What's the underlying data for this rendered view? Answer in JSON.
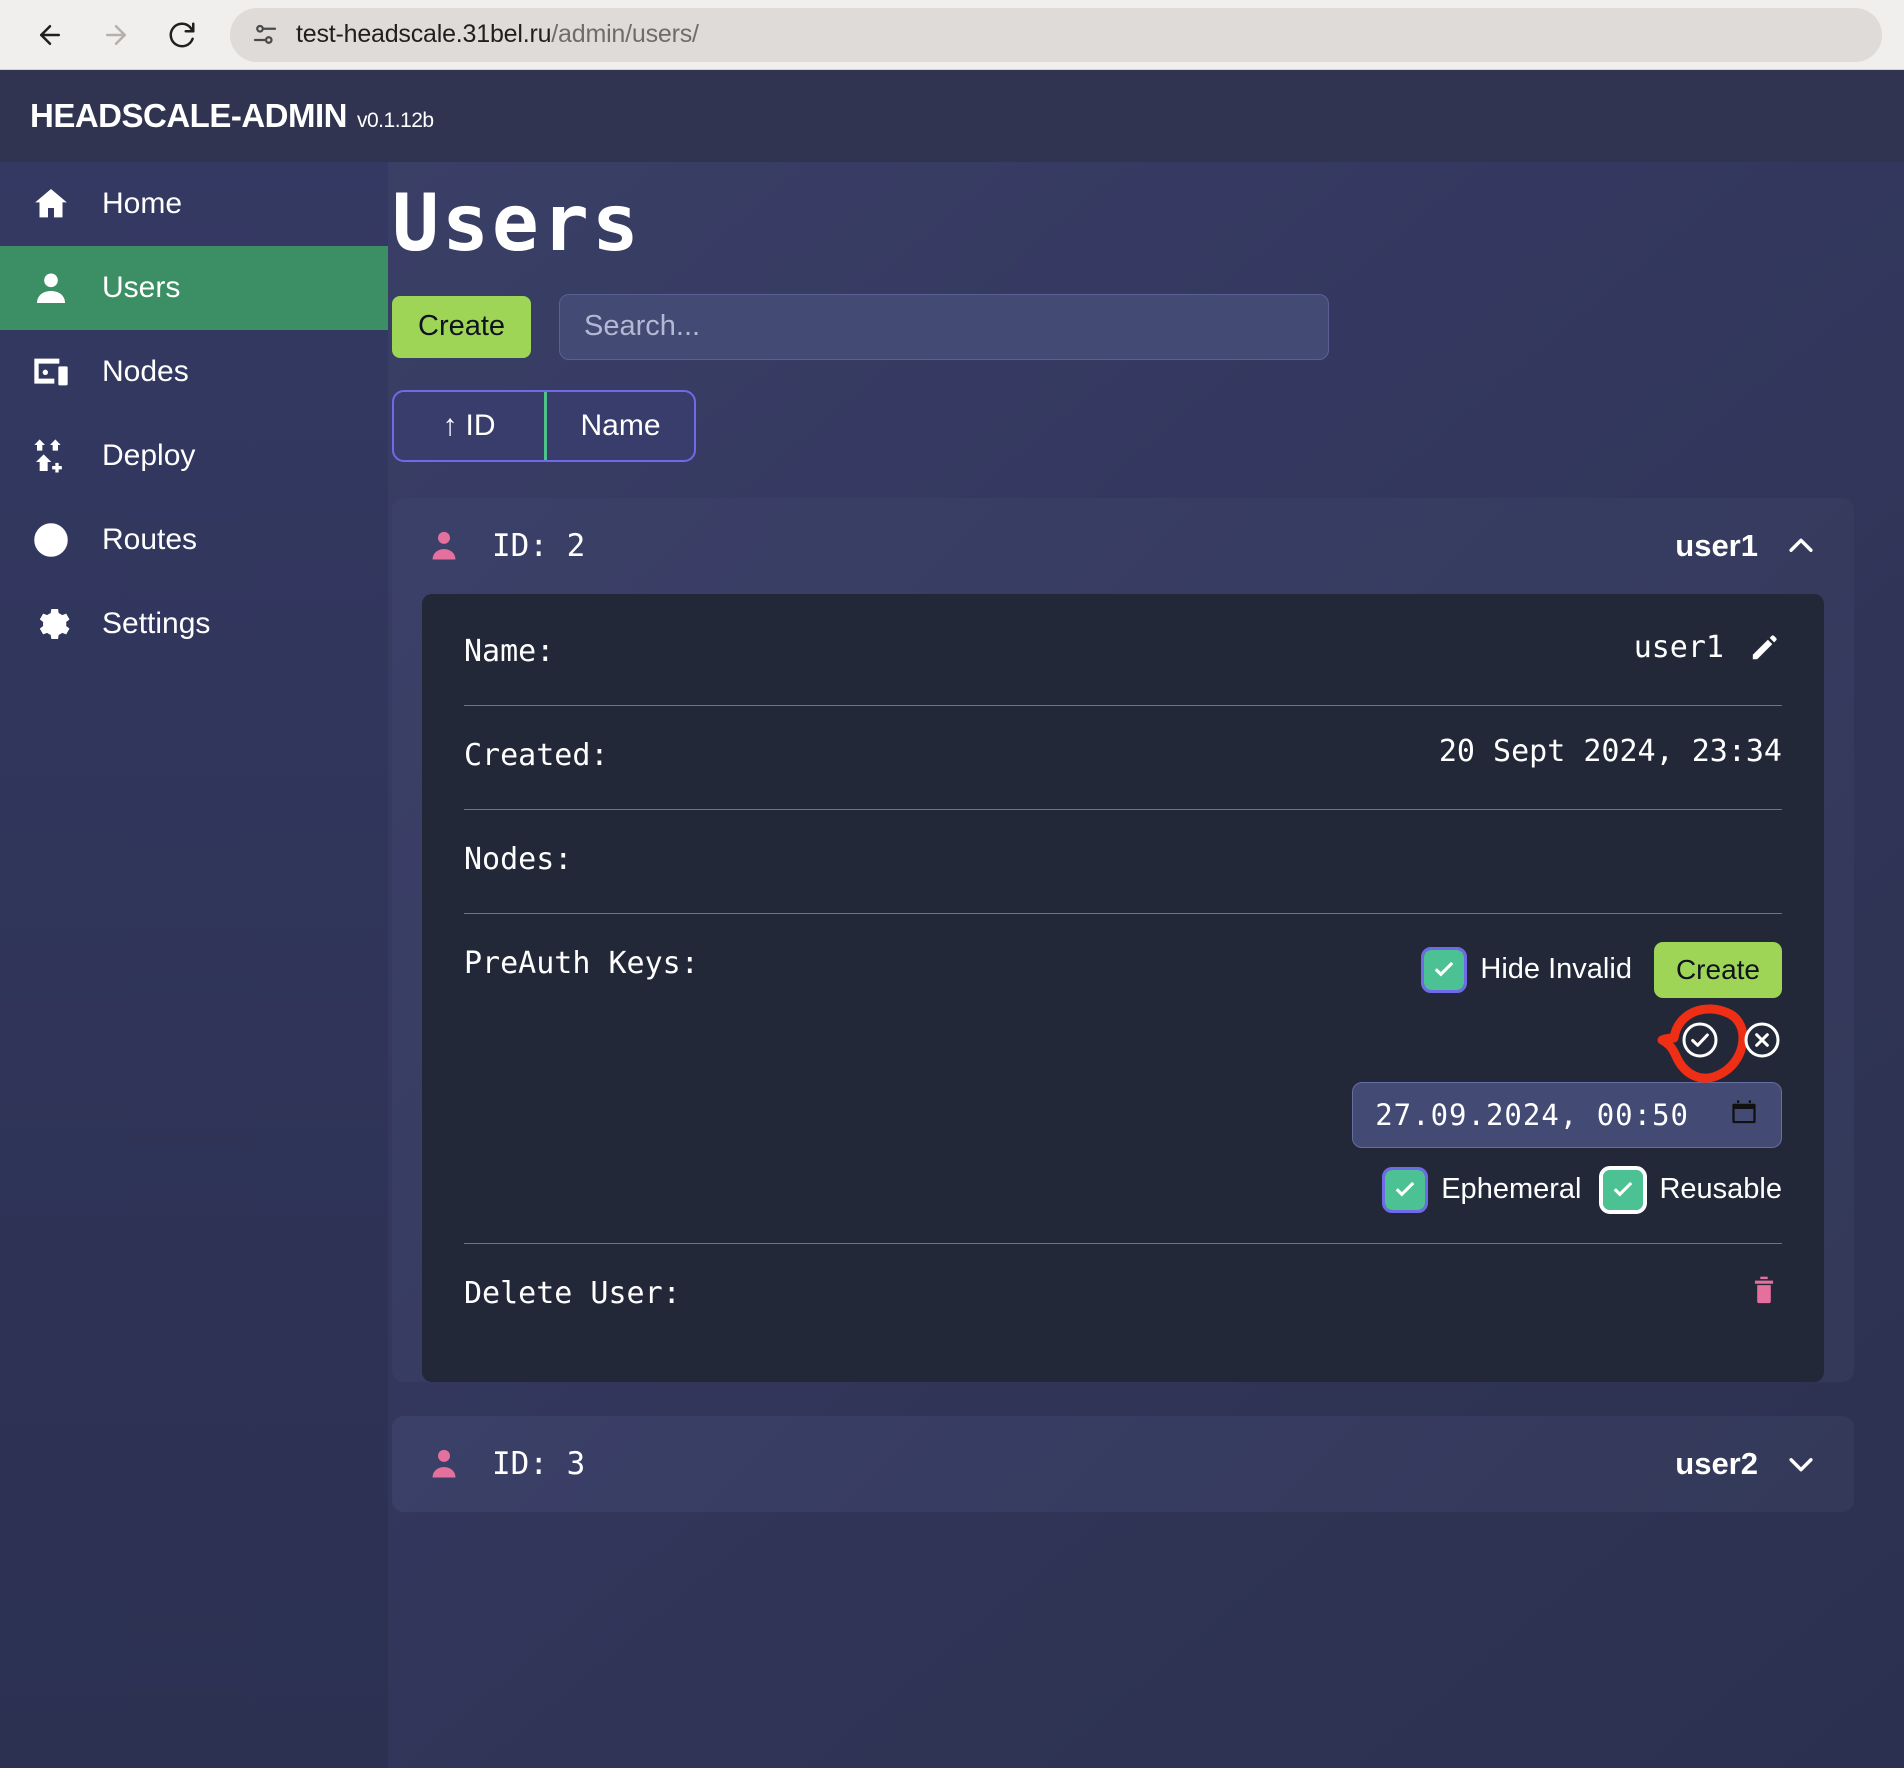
{
  "browser": {
    "back_icon": "arrow-left-icon",
    "forward_icon": "arrow-right-icon",
    "reload_icon": "reload-icon",
    "site_info_icon": "site-settings-icon",
    "url_host": "test-headscale.31bel.ru",
    "url_path": "/admin/users/"
  },
  "header": {
    "brand": "HEADSCALE-ADMIN",
    "version": "v0.1.12b"
  },
  "sidebar": {
    "items": [
      {
        "label": "Home",
        "icon": "home-icon",
        "active": false
      },
      {
        "label": "Users",
        "icon": "user-icon",
        "active": true
      },
      {
        "label": "Nodes",
        "icon": "devices-icon",
        "active": false
      },
      {
        "label": "Deploy",
        "icon": "deploy-icon",
        "active": false
      },
      {
        "label": "Routes",
        "icon": "routes-icon",
        "active": false
      },
      {
        "label": "Settings",
        "icon": "gear-icon",
        "active": false
      }
    ]
  },
  "main": {
    "title": "Users",
    "create_label": "Create",
    "search_placeholder": "Search...",
    "search_value": "",
    "sort_tabs": [
      {
        "label": "ID",
        "arrow": "↑",
        "active": true
      },
      {
        "label": "Name",
        "arrow": "",
        "active": false
      }
    ],
    "users": [
      {
        "id_label": "ID: 2",
        "username": "user1",
        "expanded": true,
        "chevron": "chevron-up-icon",
        "details": {
          "name_label": "Name:",
          "name_value": "user1",
          "edit_icon": "pencil-icon",
          "created_label": "Created:",
          "created_value": "20 Sept 2024, 23:34",
          "nodes_label": "Nodes:",
          "nodes_value": "",
          "preauth_label": "PreAuth Keys:",
          "hide_invalid_label": "Hide Invalid",
          "hide_invalid_checked": true,
          "preauth_create_label": "Create",
          "confirm_icon": "check-circle-icon",
          "cancel_icon": "x-circle-icon",
          "expiry_value": "27.09.2024, 00:50",
          "calendar_icon": "calendar-icon",
          "ephemeral_label": "Ephemeral",
          "ephemeral_checked": true,
          "reusable_label": "Reusable",
          "reusable_checked": true,
          "delete_label": "Delete User:",
          "delete_icon": "trash-icon"
        }
      },
      {
        "id_label": "ID: 3",
        "username": "user2",
        "expanded": false,
        "chevron": "chevron-down-icon"
      }
    ]
  },
  "annotation": {
    "type": "hand-drawn-circle",
    "color": "#ef2e16",
    "target": "confirm-preauth-key-button"
  },
  "colors": {
    "accent_green": "#9ed557",
    "active_nav": "#3c8f65",
    "checkbox_green": "#4cc294",
    "pink_icon": "#e4709e",
    "tab_border": "#6f6ae8",
    "annotation_red": "#ef2e16"
  }
}
